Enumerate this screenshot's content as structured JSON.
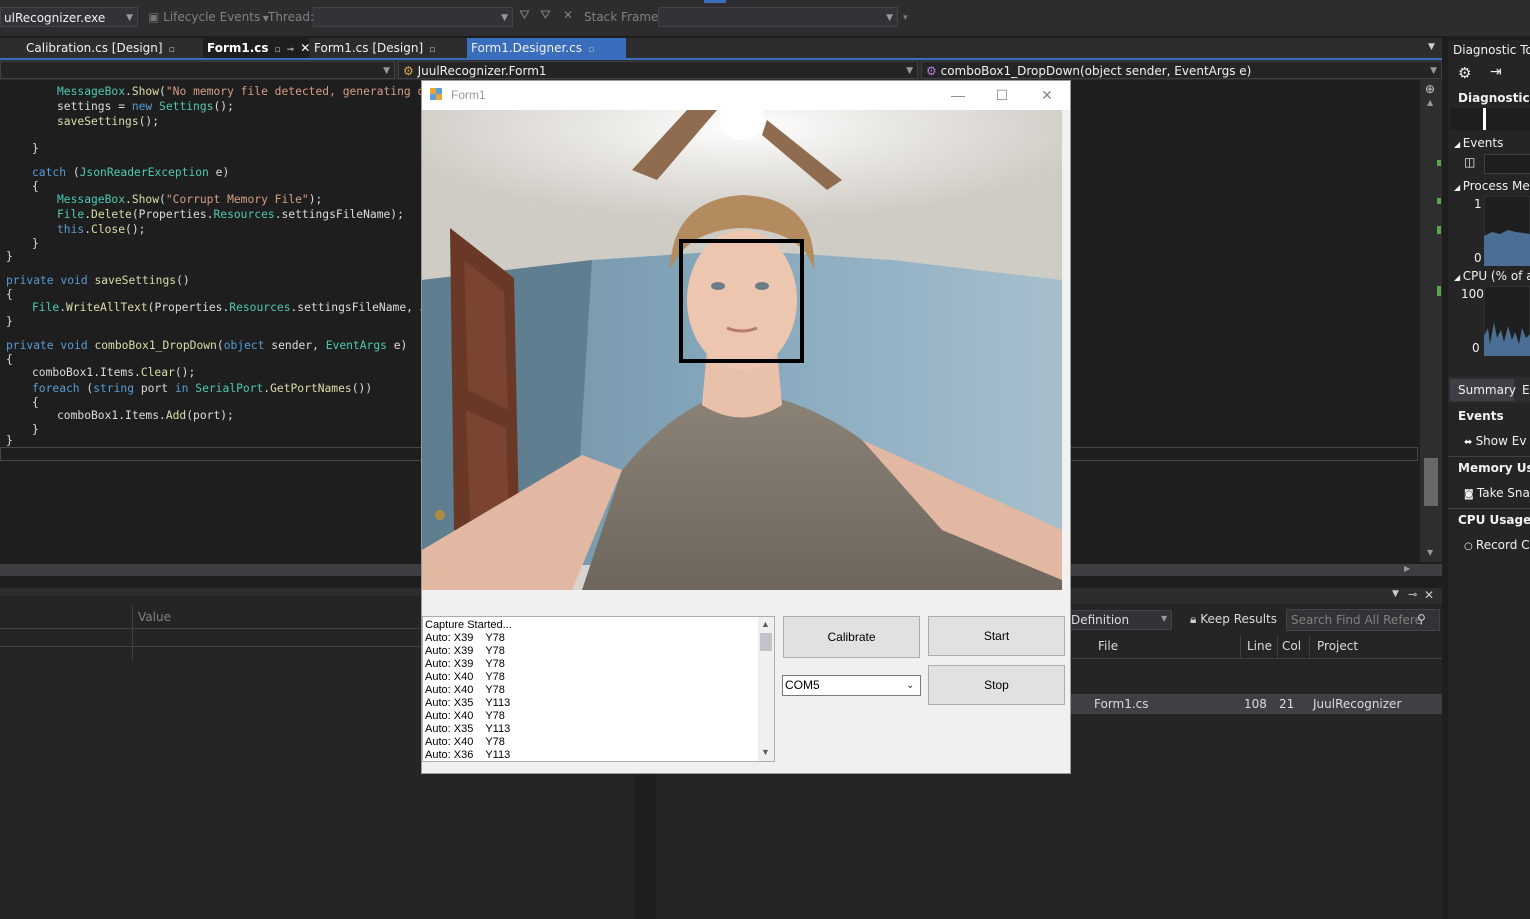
{
  "toolbar": {
    "process": "ulRecognizer.exe",
    "lifecycle": "Lifecycle Events",
    "thread_label": "Thread:",
    "stack_frame_label": "Stack Frame:"
  },
  "tabs": [
    {
      "label": "Calibration.cs [Design]"
    },
    {
      "label": "Form1.cs"
    },
    {
      "label": "Form1.cs [Design]"
    },
    {
      "label": "Form1.Designer.cs"
    }
  ],
  "navbar": {
    "class_combo": "JuulRecognizer.Form1",
    "member_combo": "comboBox1_DropDown(object sender, EventArgs e)"
  },
  "code_lines": [
    "MessageBox.Show(\"No memory file detected, generating one",
    "settings = new Settings();",
    "saveSettings();",
    "}",
    "catch (JsonReaderException e)",
    "{",
    "MessageBox.Show(\"Corrupt Memory File\");",
    "File.Delete(Properties.Resources.settingsFileName);",
    "this.Close();",
    "}",
    "}",
    "private void saveSettings()",
    "{",
    "File.WriteAllText(Properties.Resources.settingsFileName, Json",
    "}",
    "private void comboBox1_DropDown(object sender, EventArgs e)",
    "{",
    "comboBox1.Items.Clear();",
    "foreach (string port in SerialPort.GetPortNames())",
    "{",
    "comboBox1.Items.Add(port);",
    "}",
    "}"
  ],
  "locals_panel": {
    "value_header": "Value"
  },
  "find_results": {
    "definition_combo": "Definition",
    "keep_results": "Keep Results",
    "search_placeholder": "Search Find All Refere",
    "headers": [
      "File",
      "Line",
      "Col",
      "Project"
    ],
    "row": {
      "file": "Form1.cs",
      "line": "108",
      "col": "21",
      "project": "JuulRecognizer"
    }
  },
  "diagnostics": {
    "title": "Diagnostic Too",
    "session": "Diagnostics s",
    "events": "Events",
    "process_memory": "Process Mem",
    "mem_max": "1",
    "mem_min": "0",
    "cpu": "CPU (% of a",
    "cpu_max": "100",
    "cpu_min": "0",
    "tab_summary": "Summary",
    "tab_events": "Ev",
    "events_header": "Events",
    "show_events": "Show Ev",
    "memory_usage": "Memory Usag",
    "take_snapshot": "Take Sna",
    "cpu_usage": "CPU Usage",
    "record": "Record C"
  },
  "form1": {
    "title": "Form1",
    "log_lines": [
      "Capture Started...",
      "Auto: X39    Y78",
      "Auto: X39    Y78",
      "Auto: X39    Y78",
      "Auto: X40    Y78",
      "Auto: X40    Y78",
      "Auto: X35    Y113",
      "Auto: X40    Y78",
      "Auto: X35    Y113",
      "Auto: X40    Y78",
      "Auto: X36    Y113"
    ],
    "calibrate_label": "Calibrate",
    "start_label": "Start",
    "stop_label": "Stop",
    "com_value": "COM5"
  }
}
